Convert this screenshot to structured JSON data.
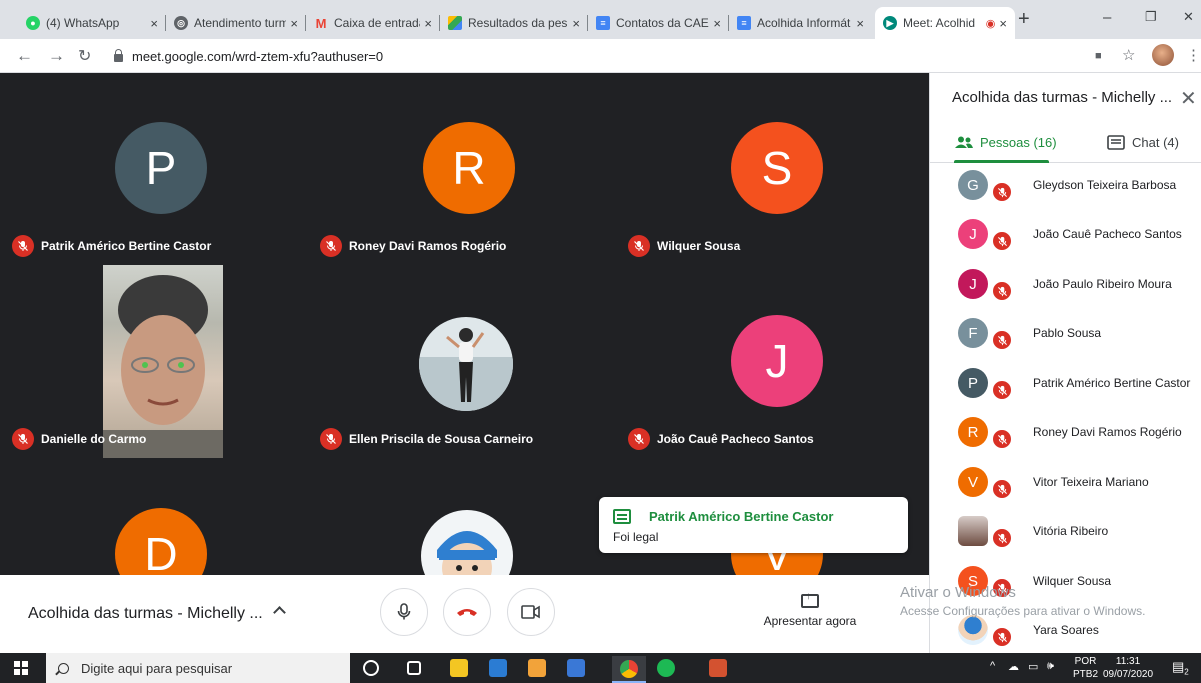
{
  "browser": {
    "tabs": [
      {
        "label": "(4) WhatsApp",
        "icon": "whatsapp-icon",
        "color": "#25d366"
      },
      {
        "label": "Atendimento turm",
        "icon": "globe-icon",
        "color": "#5f6368"
      },
      {
        "label": "Caixa de entrada (",
        "icon": "gmail-icon",
        "color": "#ea4335"
      },
      {
        "label": "Resultados da pes",
        "icon": "drive-icon",
        "color": "#fbbc04"
      },
      {
        "label": "Contatos da CAE -",
        "icon": "docs-icon",
        "color": "#4285f4"
      },
      {
        "label": "Acolhida Informát",
        "icon": "docs-icon",
        "color": "#4285f4"
      },
      {
        "label": "Meet: Acolhid",
        "icon": "meet-icon",
        "color": "#00897b"
      }
    ],
    "tab_close": "×",
    "new_tab": "+",
    "url": "meet.google.com/wrd-ztem-xfu?authuser=0",
    "win_min": "–",
    "win_restore": "❐",
    "win_close": "✕"
  },
  "meeting": {
    "title": "Acolhida das turmas - Michelly ...",
    "present_label": "Apresentar agora"
  },
  "tiles": [
    {
      "name": "Patrik Américo Bertine Castor",
      "initial": "P",
      "color": "#455a64"
    },
    {
      "name": "Roney Davi Ramos Rogério",
      "initial": "R",
      "color": "#ef6c00"
    },
    {
      "name": "Wilquer Sousa",
      "initial": "S",
      "color": "#f4511e"
    },
    {
      "name": "Danielle do Carmo",
      "initial": "",
      "color": "#202124"
    },
    {
      "name": "Ellen Priscila de Sousa Carneiro",
      "initial": "",
      "color": "#c8d6dd"
    },
    {
      "name": "João Cauê Pacheco Santos",
      "initial": "J",
      "color": "#ec407a"
    },
    {
      "name": "",
      "initial": "D",
      "color": "#ef6c00"
    },
    {
      "name": "",
      "initial": "",
      "color": "#dfe6ea"
    },
    {
      "name": "",
      "initial": "V",
      "color": "#ef6c00"
    }
  ],
  "toast": {
    "sender": "Patrik Américo Bertine Castor",
    "message": "Foi legal"
  },
  "panel": {
    "title": "Acolhida das turmas - Michelly ...",
    "close": "✕",
    "people_tab": "Pessoas (16)",
    "chat_tab": "Chat (4)",
    "people": [
      {
        "name": "Gleydson Teixeira Barbosa",
        "initial": "G",
        "color": "#78909c"
      },
      {
        "name": "João Cauê Pacheco Santos",
        "initial": "J",
        "color": "#ec407a"
      },
      {
        "name": "João Paulo Ribeiro Moura",
        "initial": "J",
        "color": "#c2185b"
      },
      {
        "name": "Pablo Sousa",
        "initial": "F",
        "color": "#78909c"
      },
      {
        "name": "Patrik Américo Bertine Castor",
        "initial": "P",
        "color": "#455a64"
      },
      {
        "name": "Roney Davi Ramos Rogério",
        "initial": "R",
        "color": "#ef6c00"
      },
      {
        "name": "Vitor Teixeira Mariano",
        "initial": "V",
        "color": "#ef6c00"
      },
      {
        "name": "Vitória Ribeiro",
        "initial": "",
        "color": "#8d6e63"
      },
      {
        "name": "Wilquer Sousa",
        "initial": "S",
        "color": "#f4511e"
      },
      {
        "name": "Yara Soares",
        "initial": "",
        "color": "#e3f2fd"
      }
    ]
  },
  "watermark": {
    "line1": "Ativar o Windows",
    "line2": "Acesse Configurações para ativar o Windows."
  },
  "taskbar": {
    "search_placeholder": "Digite aqui para pesquisar",
    "lang1": "POR",
    "lang2": "PTB2",
    "time": "11:31",
    "date": "09/07/2020",
    "notif_count": "2"
  }
}
